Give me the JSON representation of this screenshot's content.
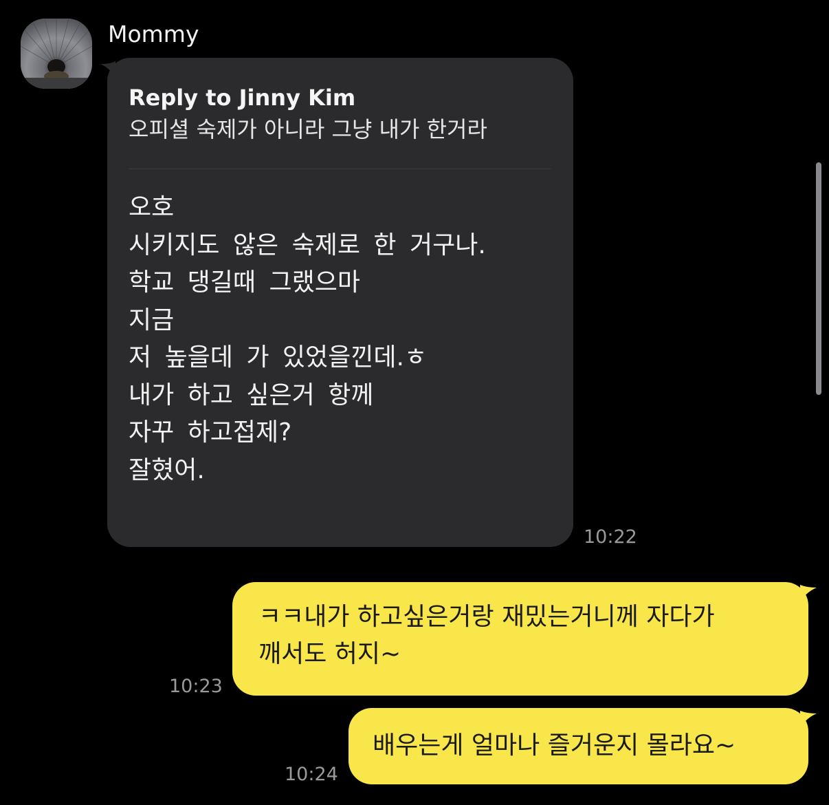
{
  "conversation": {
    "incoming": {
      "sender_name": "Mommy",
      "avatar": "profile-photo",
      "reply_label": "Reply to Jinny Kim",
      "reply_quote": "오피셜 숙제가 아니라 그냥 내가 한거라",
      "lines": [
        "오호",
        "시키지도 않은 숙제로 한 거구나.",
        "학교 댕길때 그랬으마",
        "지금",
        "저 높을데 가 있었을낀데.ㅎ",
        "내가 하고 싶은거 항께",
        "자꾸 하고접제?",
        "잘혔어."
      ],
      "time": "10:22"
    },
    "outgoing": [
      {
        "text": "ㅋㅋ내가 하고싶은거랑 재밌는거니께 자다가\n깨서도 허지~",
        "time": "10:23"
      },
      {
        "text": "배우는게 얼마나 즐거운지 몰라요~",
        "time": "10:24"
      }
    ]
  },
  "colors": {
    "background": "#000000",
    "incoming_bubble": "#2b2b2d",
    "outgoing_bubble": "#f8e64b",
    "timestamp": "#9a9a9a"
  }
}
